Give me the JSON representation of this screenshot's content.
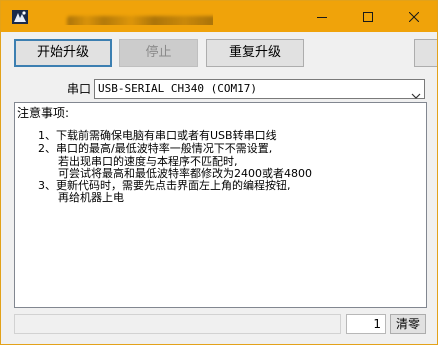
{
  "window": {
    "title": "",
    "app_icon": "app-logo-icon",
    "accent_color": "#f0a30a",
    "caption": {
      "minimize": "minimize-icon",
      "maximize": "maximize-icon",
      "close": "close-icon"
    }
  },
  "toolbar": {
    "start_label": "开始升级",
    "stop_label": "停止",
    "reupgrade_label": "重复升级",
    "extra_label": ""
  },
  "port": {
    "label": "串口",
    "selected": "USB-SERIAL CH340 (COM17)"
  },
  "notes": {
    "title": "注意事项:",
    "lines": [
      "1、下载前需确保电脑有串口或者有USB转串口线",
      "2、串口的最高/最低波特率一般情况下不需设置,",
      "若出现串口的速度与本程序不匹配时,",
      "可尝试将最高和最低波特率都修改为2400或者4800",
      "3、更新代码时，需要先点击界面左上角的编程按钮,",
      "再给机器上电"
    ]
  },
  "status": {
    "text": "",
    "count": "1",
    "clear_label": "清零"
  }
}
